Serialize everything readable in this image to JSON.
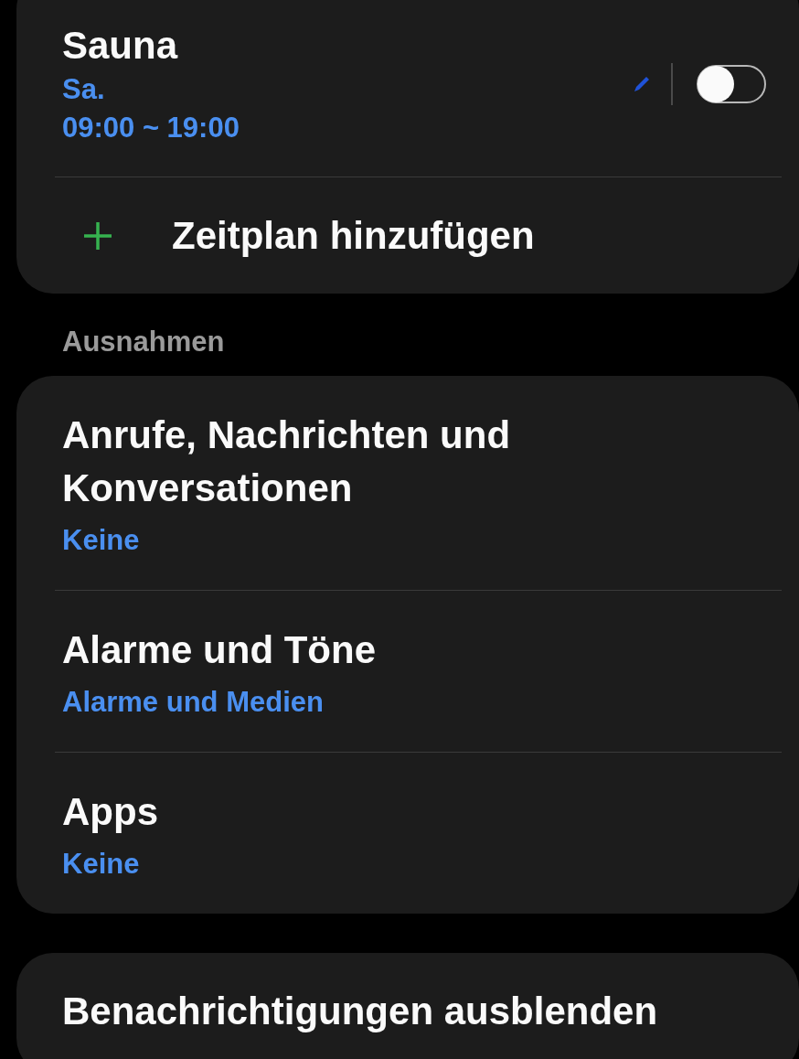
{
  "schedule": {
    "title": "Sauna",
    "days": "Sa.",
    "time": "09:00 ~ 19:00",
    "on": false
  },
  "add_schedule": {
    "label": "Zeitplan hinzufügen"
  },
  "exceptions": {
    "header": "Ausnahmen",
    "items": [
      {
        "title": "Anrufe, Nachrichten und Konversationen",
        "value": "Keine"
      },
      {
        "title": "Alarme und Töne",
        "value": "Alarme und Medien"
      },
      {
        "title": "Apps",
        "value": "Keine"
      }
    ]
  },
  "hide_notifications": {
    "title": "Benachrichtigungen ausblenden"
  }
}
